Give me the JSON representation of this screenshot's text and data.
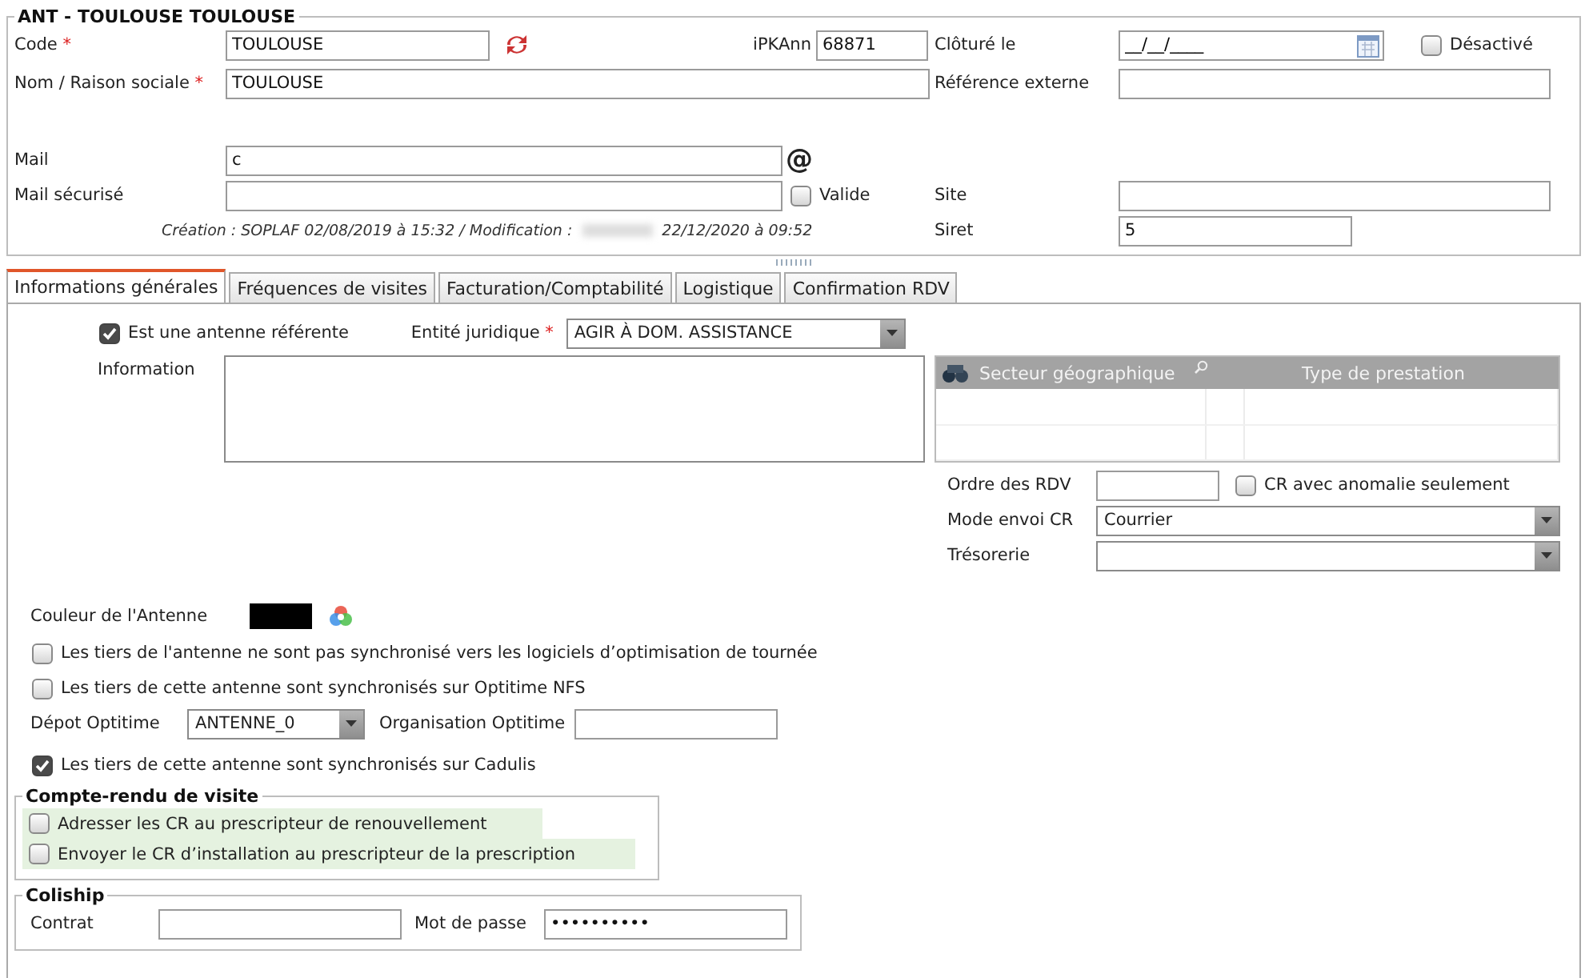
{
  "record": {
    "title": "ANT - TOULOUSE TOULOUSE",
    "code": {
      "label": "Code",
      "required_mark": "*",
      "value": "TOULOUSE"
    },
    "ipkann": {
      "label": "iPKAnn",
      "value": "68871"
    },
    "cloture": {
      "label": "Clôturé le",
      "value": "__/__/____"
    },
    "desactive": {
      "label": "Désactivé",
      "checked": false
    },
    "nom": {
      "label": "Nom / Raison sociale",
      "required_mark": "*",
      "value": "TOULOUSE"
    },
    "reference_externe": {
      "label": "Référence externe"
    },
    "mail": {
      "label": "Mail",
      "value": "c",
      "symbol": "@"
    },
    "mail_securise": {
      "label": "Mail sécurisé"
    },
    "valide": {
      "label": "Valide",
      "checked": false
    },
    "site": {
      "label": "Site"
    },
    "siret": {
      "label": "Siret",
      "value": "5"
    },
    "audit": [
      "Création : SOPLAF 02/08/2019 à 15:32 / Modification :",
      "22/12/2020 à 09:52"
    ]
  },
  "tabs": [
    {
      "label": "Informations générales",
      "selected": true
    },
    {
      "label": "Fréquences de visites",
      "selected": false
    },
    {
      "label": "Facturation/Comptabilité",
      "selected": false
    },
    {
      "label": "Logistique",
      "selected": false
    },
    {
      "label": "Confirmation RDV",
      "selected": false
    }
  ],
  "general": {
    "antenne_referente": {
      "label": "Est une antenne référente",
      "checked": true
    },
    "entite_juridique": {
      "label": "Entité juridique",
      "required_mark": "*",
      "value": "AGIR À DOM. ASSISTANCE"
    },
    "information": {
      "label": "Information"
    },
    "sectors_table": {
      "columns": [
        "Secteur géographique",
        "Type de prestation"
      ]
    },
    "ordre_rdv": {
      "label": "Ordre des RDV"
    },
    "cr_anomalie": {
      "label": "CR avec anomalie seulement",
      "checked": false
    },
    "mode_envoi": {
      "label": "Mode envoi CR",
      "value": "Courrier"
    },
    "tresorerie": {
      "label": "Trésorerie"
    },
    "couleur": {
      "label": "Couleur de l'Antenne",
      "color": "#000000"
    },
    "sync_options": [
      {
        "label": "Les tiers de l'antenne ne sont pas synchronisé vers les logiciels d’optimisation de tournée",
        "checked": false
      },
      {
        "label": "Les tiers de cette antenne sont synchronisés sur Optitime NFS",
        "checked": false
      }
    ],
    "depot": {
      "label": "Dépot Optitime",
      "value": "ANTENNE_0"
    },
    "organisation": {
      "label": "Organisation Optitime"
    },
    "cadulis": {
      "label": "Les tiers de cette antenne sont synchronisés sur Cadulis",
      "checked": true
    },
    "compte_rendu": {
      "title": "Compte-rendu de visite",
      "options": [
        {
          "label": "Adresser les CR au prescripteur de renouvellement",
          "checked": false
        },
        {
          "label": "Envoyer le CR d’installation au prescripteur de la prescription",
          "checked": false
        }
      ]
    },
    "coliship": {
      "title": "Coliship",
      "contrat": {
        "label": "Contrat"
      },
      "mot_de_passe": {
        "label": "Mot de passe",
        "value": "••••••••••"
      }
    }
  }
}
